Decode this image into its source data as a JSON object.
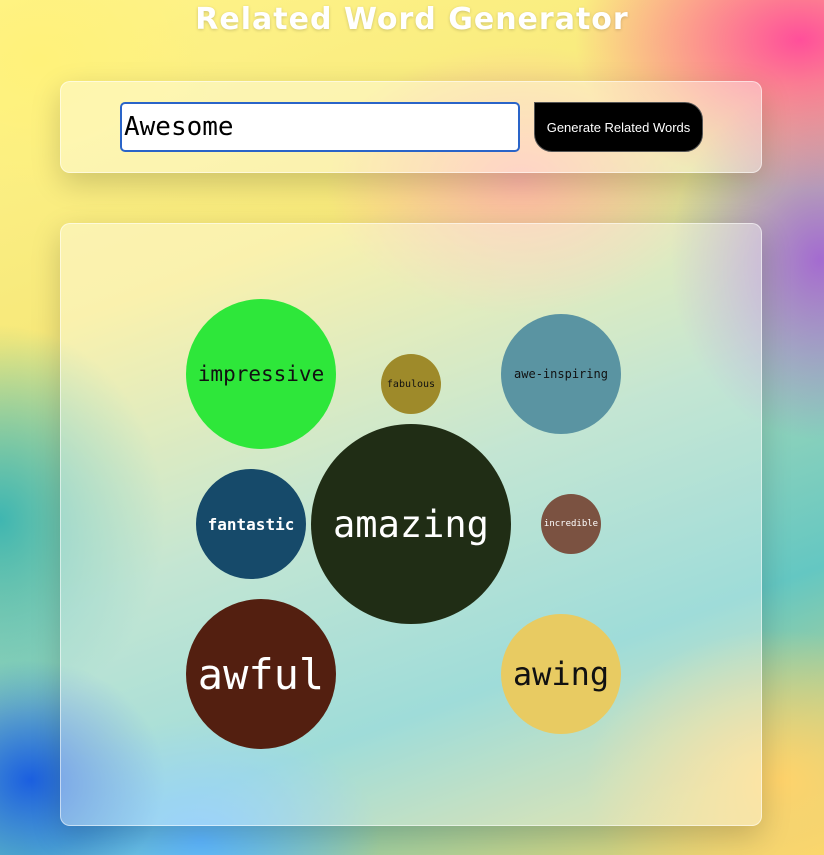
{
  "header": {
    "title": "Related Word Generator"
  },
  "search": {
    "value": "Awesome",
    "button_label": "Generate Related Words"
  },
  "words": [
    {
      "label": "impressive",
      "color": "#2ee73a",
      "text_color": "#111111"
    },
    {
      "label": "fabulous",
      "color": "#9e8a2a",
      "text_color": "#111111"
    },
    {
      "label": "awe-inspiring",
      "color": "#5a94a2",
      "text_color": "#111111"
    },
    {
      "label": "fantastic",
      "color": "#164a6a",
      "text_color": "#ffffff"
    },
    {
      "label": "amazing",
      "color": "#202d15",
      "text_color": "#ffffff"
    },
    {
      "label": "incredible",
      "color": "#7b5241",
      "text_color": "#ffffff"
    },
    {
      "label": "awful",
      "color": "#531f10",
      "text_color": "#ffffff"
    },
    {
      "label": "awing",
      "color": "#e8cb62",
      "text_color": "#111111"
    }
  ]
}
